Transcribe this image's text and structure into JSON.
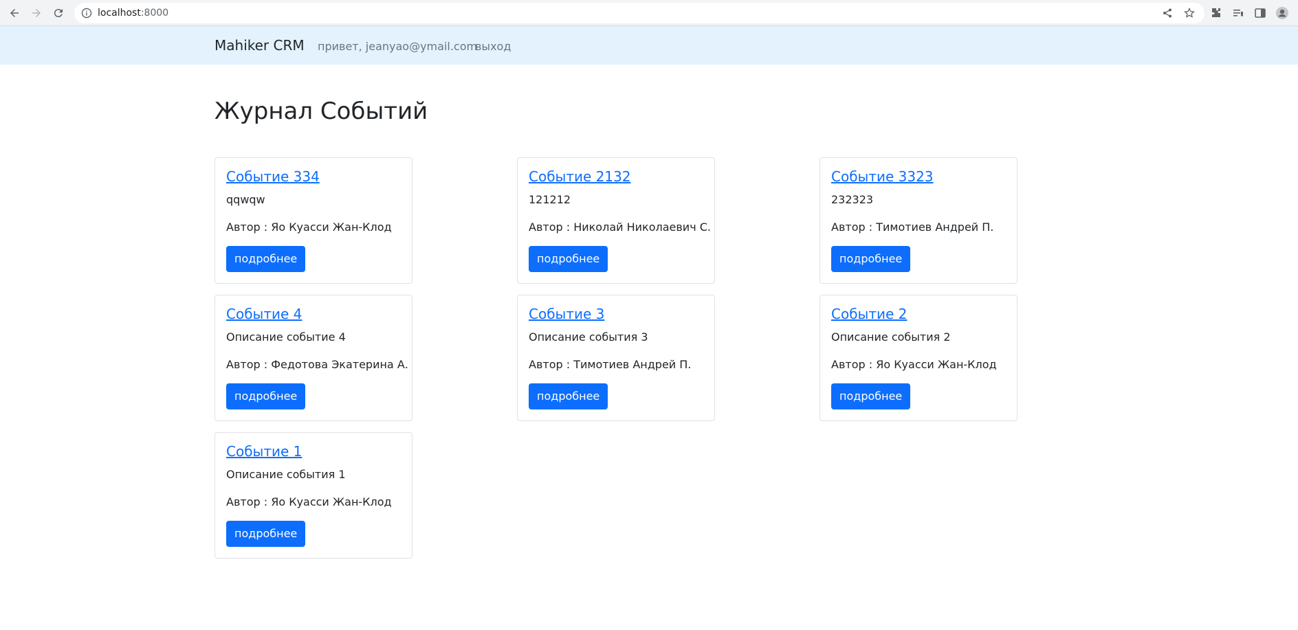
{
  "browser": {
    "url_host": "localhost",
    "url_port": ":8000"
  },
  "navbar": {
    "brand": "Mahiker CRM",
    "greeting": "привет, jeanyao@ymail.com",
    "logout": "выход"
  },
  "main": {
    "title": "Журнал Событий",
    "details_label": "подробнее",
    "events": [
      {
        "title": "Событие 334",
        "description": "qqwqw",
        "author": "Автор : Яо Куасси Жан-Клод"
      },
      {
        "title": "Событие 2132",
        "description": "121212",
        "author": "Автор : Николай Николаевич С."
      },
      {
        "title": "Событие 3323",
        "description": "232323",
        "author": "Автор : Тимотиев Андрей П."
      },
      {
        "title": "Событие 4",
        "description": "Описание событие 4",
        "author": "Автор : Федотова Экатерина А."
      },
      {
        "title": "Событие 3",
        "description": "Описание события 3",
        "author": "Автор : Тимотиев Андрей П."
      },
      {
        "title": "Событие 2",
        "description": "Описание события 2",
        "author": "Автор : Яо Куасси Жан-Клод"
      },
      {
        "title": "Событие 1",
        "description": "Описание события 1",
        "author": "Автор : Яо Куасси Жан-Клод"
      }
    ]
  }
}
